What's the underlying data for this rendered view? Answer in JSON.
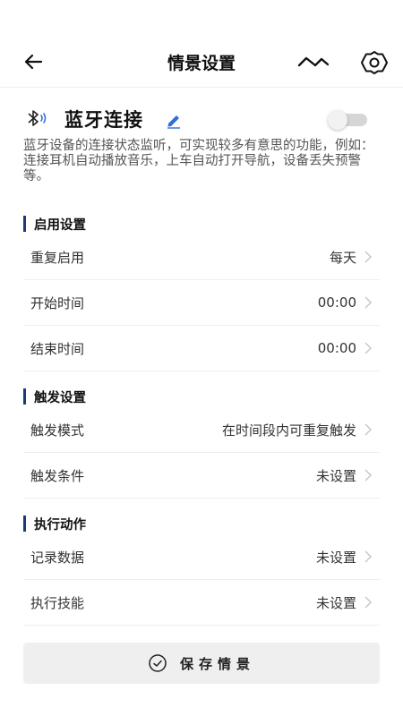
{
  "header": {
    "title": "情景设置",
    "back_icon": "arrow-left-icon",
    "trend_icon": "wave-chart-icon",
    "settings_icon": "gear-icon"
  },
  "scene": {
    "name": "蓝牙连接",
    "icon": "bluetooth-icon",
    "edit_icon": "pencil-icon",
    "enabled": false,
    "description": "蓝牙设备的连接状态监听，可实现较多有意思的功能，例如：连接耳机自动播放音乐，上车自动打开导航，设备丢失预警等。"
  },
  "sections": {
    "enable": {
      "title": "启用设置",
      "rows": [
        {
          "label": "重复启用",
          "value": "每天"
        },
        {
          "label": "开始时间",
          "value": "00:00"
        },
        {
          "label": "结束时间",
          "value": "00:00"
        }
      ]
    },
    "trigger": {
      "title": "触发设置",
      "rows": [
        {
          "label": "触发模式",
          "value": "在时间段内可重复触发"
        },
        {
          "label": "触发条件",
          "value": "未设置"
        }
      ]
    },
    "action": {
      "title": "执行动作",
      "rows": [
        {
          "label": "记录数据",
          "value": "未设置"
        },
        {
          "label": "执行技能",
          "value": "未设置"
        }
      ]
    }
  },
  "save_button": {
    "label": "保存情景",
    "icon": "check-circle-icon"
  },
  "colors": {
    "accent": "#1b3a78",
    "edit_icon": "#2f6fd6"
  }
}
